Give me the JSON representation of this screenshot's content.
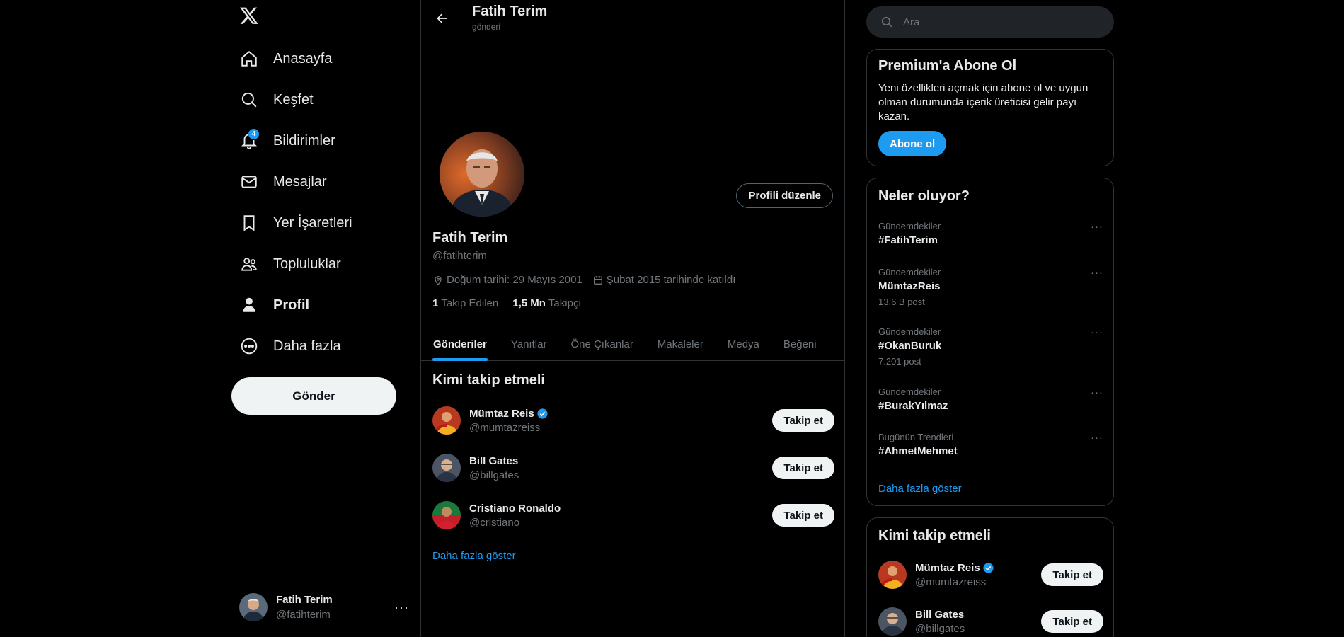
{
  "nav": {
    "items": [
      {
        "label": "Anasayfa",
        "icon": "home-icon"
      },
      {
        "label": "Keşfet",
        "icon": "search-icon"
      },
      {
        "label": "Bildirimler",
        "icon": "bell-icon",
        "badge": "4"
      },
      {
        "label": "Mesajlar",
        "icon": "mail-icon"
      },
      {
        "label": "Yer İşaretleri",
        "icon": "bookmark-icon"
      },
      {
        "label": "Topluluklar",
        "icon": "communities-icon"
      },
      {
        "label": "Profil",
        "icon": "profile-icon"
      },
      {
        "label": "Daha fazla",
        "icon": "more-circle-icon"
      }
    ],
    "post_label": "Gönder",
    "account": {
      "name": "Fatih Terim",
      "handle": "@fatihterim",
      "more": "···"
    }
  },
  "topbar": {
    "title": "Fatih Terim",
    "subtitle": "gönderi"
  },
  "profile": {
    "name": "Fatih Terim",
    "handle": "@fatihterim",
    "edit_label": "Profili düzenle",
    "birth": "Doğum tarihi: 29 Mayıs 2001",
    "joined": "Şubat 2015 tarihinde katıldı",
    "following_count": "1",
    "following_label": "Takip Edilen",
    "followers_count": "1,5 Mn",
    "followers_label": "Takipçi"
  },
  "tabs": [
    "Gönderiler",
    "Yanıtlar",
    "Öne Çıkanlar",
    "Makaleler",
    "Medya",
    "Beğeni"
  ],
  "who_to_follow": {
    "title": "Kimi takip etmeli",
    "follow_label": "Takip et",
    "show_more": "Daha fazla göster",
    "users": [
      {
        "name": "Mümtaz Reis",
        "handle": "@mumtazreiss",
        "verified": true
      },
      {
        "name": "Bill Gates",
        "handle": "@billgates",
        "verified": false
      },
      {
        "name": "Cristiano Ronaldo",
        "handle": "@cristiano",
        "verified": false
      }
    ]
  },
  "search": {
    "placeholder": "Ara"
  },
  "premium": {
    "title": "Premium'a Abone Ol",
    "text": "Yeni özellikleri açmak için abone ol ve uygun olman durumunda içerik üreticisi gelir payı kazan.",
    "button": "Abone ol"
  },
  "trends": {
    "title": "Neler oluyor?",
    "show_more": "Daha fazla göster",
    "items": [
      {
        "context": "Gündemdekiler",
        "name": "#FatihTerim",
        "count": ""
      },
      {
        "context": "Gündemdekiler",
        "name": "MümtazReis",
        "count": "13,6 B post"
      },
      {
        "context": "Gündemdekiler",
        "name": "#OkanBuruk",
        "count": "7.201 post"
      },
      {
        "context": "Gündemdekiler",
        "name": "#BurakYılmaz",
        "count": ""
      },
      {
        "context": "Bugünün Trendleri",
        "name": "#AhmetMehmet",
        "count": ""
      }
    ]
  },
  "who_to_follow_right": {
    "title": "Kimi takip etmeli",
    "follow_label": "Takip et",
    "users": [
      {
        "name": "Mümtaz Reis",
        "handle": "@mumtazreiss",
        "verified": true
      },
      {
        "name": "Bill Gates",
        "handle": "@billgates",
        "verified": false
      }
    ]
  },
  "colors": {
    "accent": "#1d9bf0",
    "background": "#000000",
    "border": "#2f3336",
    "muted": "#71767b"
  }
}
